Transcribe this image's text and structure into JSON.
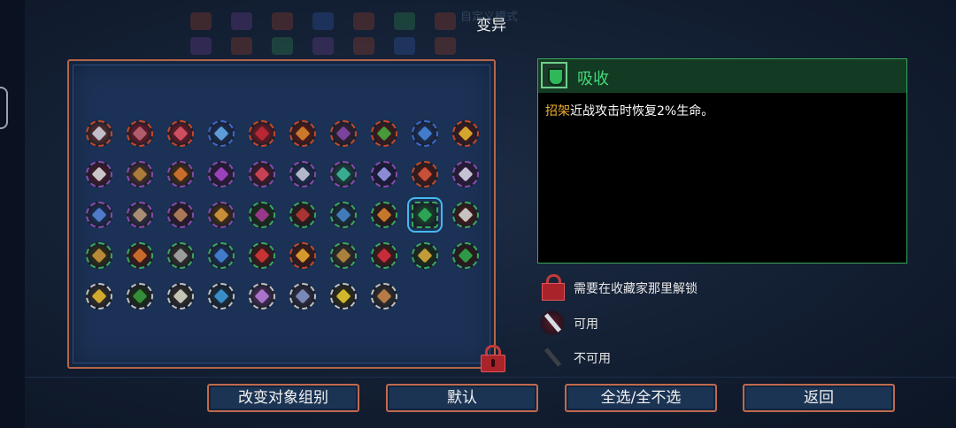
{
  "screen": {
    "title": "变异",
    "background_hint": "自定义模式"
  },
  "mutation_grid": {
    "rows": [
      [
        {
          "name": "sword-icon",
          "ring": "#c24a2a",
          "c1": "#4a2a2e",
          "c2": "#d7d7e3"
        },
        {
          "name": "bow-icon",
          "ring": "#c24a2a",
          "c1": "#5a1a28",
          "c2": "#c06a7a"
        },
        {
          "name": "claw-icon",
          "ring": "#c24a2a",
          "c1": "#5a1a28",
          "c2": "#e05a6a"
        },
        {
          "name": "ice-blades-icon",
          "ring": "#3a6ad0",
          "c1": "#1a2a4a",
          "c2": "#6ab0f0"
        },
        {
          "name": "red-rune-icon",
          "ring": "#c24a2a",
          "c1": "#5a1a24",
          "c2": "#c82a3a"
        },
        {
          "name": "fire-bell-icon",
          "ring": "#c24a2a",
          "c1": "#4a1a1a",
          "c2": "#e08a30"
        },
        {
          "name": "dragon-icon",
          "ring": "#c24a2a",
          "c1": "#2a2030",
          "c2": "#8a4ab0"
        },
        {
          "name": "green-crown-icon",
          "ring": "#c24a2a",
          "c1": "#3a1a20",
          "c2": "#4ab040"
        },
        {
          "name": "potion-icon",
          "ring": "#3a6ad0",
          "c1": "#1a2a4a",
          "c2": "#4a8ae0"
        },
        {
          "name": "lightning-icon",
          "ring": "#c24a2a",
          "c1": "#3a1a20",
          "c2": "#f0c030"
        }
      ],
      [
        {
          "name": "ghost-icon",
          "ring": "#8a4ab0",
          "c1": "#3a1a2a",
          "c2": "#e4e4e4"
        },
        {
          "name": "hammer-icon",
          "ring": "#8a4ab0",
          "c1": "#3a2a2a",
          "c2": "#c08a40"
        },
        {
          "name": "orange-orb-icon",
          "ring": "#8a4ab0",
          "c1": "#3a2a1a",
          "c2": "#e07a30"
        },
        {
          "name": "purple-hook-icon",
          "ring": "#8a4ab0",
          "c1": "#2a1a3a",
          "c2": "#b04ad0"
        },
        {
          "name": "cross-blade-icon",
          "ring": "#8a4ab0",
          "c1": "#3a1a2a",
          "c2": "#e04a5a"
        },
        {
          "name": "trident-icon",
          "ring": "#8a4ab0",
          "c1": "#1a2a4a",
          "c2": "#d0d0e0"
        },
        {
          "name": "arrow-up-icon",
          "ring": "#8a4ab0",
          "c1": "#1a3a3a",
          "c2": "#40c0a0"
        },
        {
          "name": "wings-icon",
          "ring": "#8a4ab0",
          "c1": "#1a1a3a",
          "c2": "#a0a0f0"
        },
        {
          "name": "forbidden-icon",
          "ring": "#c24a2a",
          "c1": "#3a1a1a",
          "c2": "#e05a40"
        },
        {
          "name": "snake-icon",
          "ring": "#8a4ab0",
          "c1": "#2a1a3a",
          "c2": "#e0e0f0"
        }
      ],
      [
        {
          "name": "blue-slash-icon",
          "ring": "#8a4ab0",
          "c1": "#1a2a4a",
          "c2": "#5a8ae0"
        },
        {
          "name": "crossbow-icon",
          "ring": "#8a4ab0",
          "c1": "#2a2a3a",
          "c2": "#c0a080"
        },
        {
          "name": "spear-icon",
          "ring": "#8a4ab0",
          "c1": "#2a1a2a",
          "c2": "#c08a60"
        },
        {
          "name": "hammer-fist-icon",
          "ring": "#8a4ab0",
          "c1": "#3a2a1a",
          "c2": "#e0a040"
        },
        {
          "name": "drop-icon",
          "ring": "#3aa85a",
          "c1": "#1a2a1a",
          "c2": "#b03aa0"
        },
        {
          "name": "skull-mask-icon",
          "ring": "#3aa85a",
          "c1": "#2a1a1a",
          "c2": "#c03a3a"
        },
        {
          "name": "blue-face-icon",
          "ring": "#3aa85a",
          "c1": "#1a2a3a",
          "c2": "#4a8ad0"
        },
        {
          "name": "gold-shield-icon",
          "ring": "#3aa85a",
          "c1": "#2a1a1a",
          "c2": "#e08a30"
        },
        {
          "name": "green-shield-icon",
          "ring": "#3aa85a",
          "c1": "#1a3a2a",
          "c2": "#2fb85a"
        },
        {
          "name": "fangs-icon",
          "ring": "#3aa85a",
          "c1": "#3a1a1a",
          "c2": "#e0e0e0"
        }
      ],
      [
        {
          "name": "knight-icon",
          "ring": "#3aa85a",
          "c1": "#2a2a1a",
          "c2": "#d09a40"
        },
        {
          "name": "dagger-icon",
          "ring": "#3aa85a",
          "c1": "#3a1a1a",
          "c2": "#e07a30"
        },
        {
          "name": "grey-c-icon",
          "ring": "#3aa85a",
          "c1": "#2a2a2a",
          "c2": "#b0b0b0"
        },
        {
          "name": "blue-gate-icon",
          "ring": "#3aa85a",
          "c1": "#1a2a4a",
          "c2": "#4a8ae0"
        },
        {
          "name": "fire-heart-icon",
          "ring": "#3aa85a",
          "c1": "#3a1a1a",
          "c2": "#e03a3a"
        },
        {
          "name": "chevrons-icon",
          "ring": "#c24a2a",
          "c1": "#3a1a1a",
          "c2": "#f0b030"
        },
        {
          "name": "armor-icon",
          "ring": "#3aa85a",
          "c1": "#2a2a2a",
          "c2": "#c09040"
        },
        {
          "name": "red-bolt-icon",
          "ring": "#3aa85a",
          "c1": "#3a1a1a",
          "c2": "#e03040"
        },
        {
          "name": "golden-horn-icon",
          "ring": "#3aa85a",
          "c1": "#1a2a1a",
          "c2": "#e0b040"
        },
        {
          "name": "green-fist-icon",
          "ring": "#3aa85a",
          "c1": "#2a1a1a",
          "c2": "#30b050"
        }
      ],
      [
        {
          "name": "speed-icon",
          "ring": "#c0c0c0",
          "c1": "#2a2a2a",
          "c2": "#f0c030"
        },
        {
          "name": "green-tree-icon",
          "ring": "#c0c0c0",
          "c1": "#1a2a1a",
          "c2": "#3aa040"
        },
        {
          "name": "skull-icon",
          "ring": "#c0c0c0",
          "c1": "#2a2a2a",
          "c2": "#e0e0d0"
        },
        {
          "name": "blue-crown-icon",
          "ring": "#c0c0c0",
          "c1": "#1a2a3a",
          "c2": "#40a0e0"
        },
        {
          "name": "purple-orb-icon",
          "ring": "#c0c0c0",
          "c1": "#3a2a4a",
          "c2": "#c080e0"
        },
        {
          "name": "axe-icon",
          "ring": "#c0c0c0",
          "c1": "#2a2a3a",
          "c2": "#8a9ad0"
        },
        {
          "name": "sun-icon",
          "ring": "#c0c0c0",
          "c1": "#2a2a1a",
          "c2": "#f0d030"
        },
        {
          "name": "stick-icon",
          "ring": "#c0c0c0",
          "c1": "#2a2a2a",
          "c2": "#d08a50"
        }
      ]
    ]
  },
  "selected": {
    "name": "吸收",
    "keyword": "招架",
    "description": "近战攻击时恢复2%生命。"
  },
  "legend": {
    "locked": "需要在收藏家那里解锁",
    "available": "可用",
    "unavailable": "不可用"
  },
  "buttons": {
    "change_group": "改变对象组别",
    "default": "默认",
    "select_all": "全选/全不选",
    "back": "返回"
  }
}
